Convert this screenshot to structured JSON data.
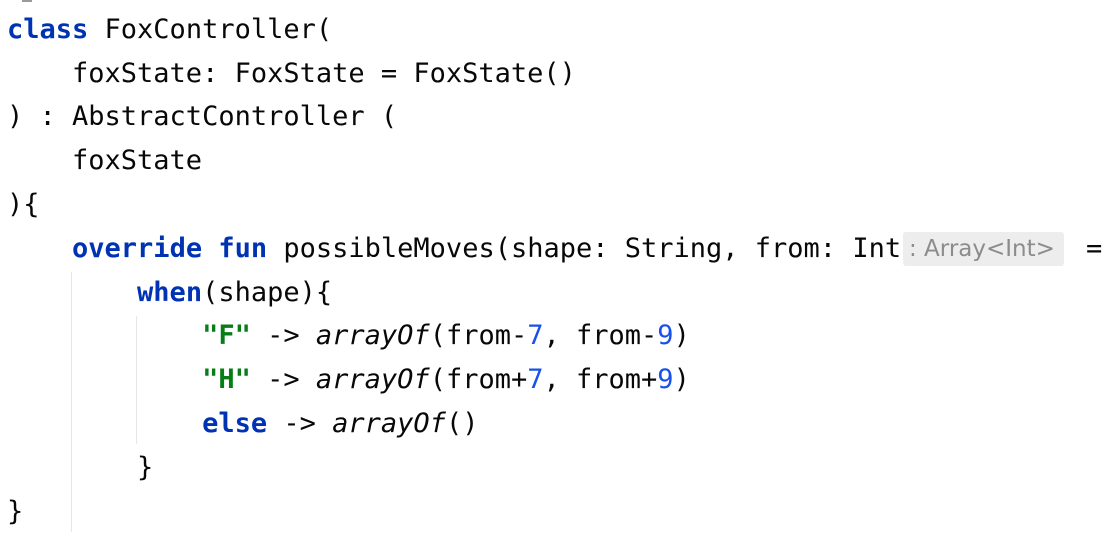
{
  "code": {
    "line1": {
      "kw": "class",
      "rest": " FoxController("
    },
    "line2": {
      "text": "    foxState: FoxState = FoxState()"
    },
    "line3": {
      "text": ") : AbstractController ("
    },
    "line4": {
      "text": "    foxState"
    },
    "line5": {
      "text": "){"
    },
    "line6": {
      "indent": "    ",
      "kw1": "override",
      "sp": " ",
      "kw2": "fun",
      "rest": " possibleMoves(shape: String, from: Int)"
    },
    "line7": {
      "indent": "        ",
      "kw": "when",
      "rest": "(shape){"
    },
    "line8": {
      "indent": "            ",
      "str": "\"F\"",
      "arrow": " -> ",
      "fn": "arrayOf",
      "p1": "(from-",
      "n1": "7",
      "p2": ", from-",
      "n2": "9",
      "p3": ")"
    },
    "line9": {
      "indent": "            ",
      "str": "\"H\"",
      "arrow": " -> ",
      "fn": "arrayOf",
      "p1": "(from+",
      "n1": "7",
      "p2": ", from+",
      "n2": "9",
      "p3": ")"
    },
    "line10": {
      "indent": "            ",
      "kw": "else",
      "arrow": " -> ",
      "fn": "arrayOf",
      "rest": "()"
    },
    "line11": {
      "text": "        }"
    },
    "line12": {
      "text": "}"
    }
  },
  "inlay_hint": ": Array<Int>",
  "trailing_eq": "=",
  "colors": {
    "keyword": "#0033b3",
    "string": "#067d17",
    "number": "#1750eb",
    "text": "#080808",
    "hint_bg": "#ededed",
    "hint_text": "#8c8c8c"
  }
}
